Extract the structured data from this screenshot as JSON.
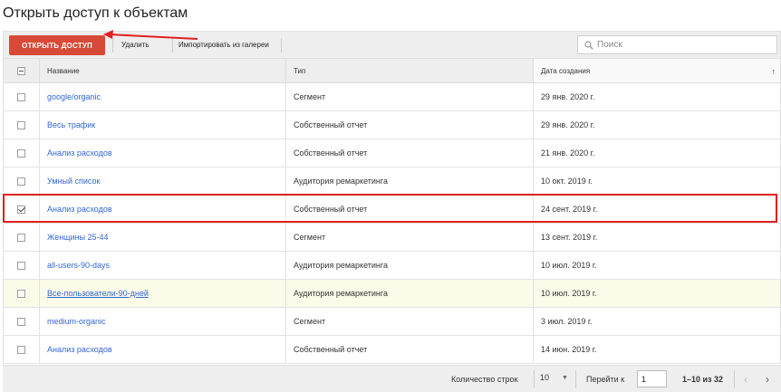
{
  "page": {
    "title": "Открыть доступ к объектам"
  },
  "toolbar": {
    "share_label": "ОТКРЫТЬ ДОСТУП",
    "delete_label": "Удалить",
    "import_label": "Импортировать из галереи",
    "search_placeholder": "Поиск"
  },
  "table": {
    "headers": {
      "name": "Название",
      "type": "Тип",
      "date": "Дата создания"
    },
    "sorted_by": "Дата создания",
    "sort_indicator": "↑",
    "rows": [
      {
        "name": "google/organic",
        "type": "Сегмент",
        "date": "29 янв. 2020 г.",
        "checked": false
      },
      {
        "name": "Весь трафик",
        "type": "Собственный отчет",
        "date": "29 янв. 2020 г.",
        "checked": false
      },
      {
        "name": "Анализ расходов",
        "type": "Собственный отчет",
        "date": "21 янв. 2020 г.",
        "checked": false
      },
      {
        "name": "Умный список",
        "type": "Аудитория ремаркетинга",
        "date": "10 окт. 2019 г.",
        "checked": false
      },
      {
        "name": "Анализ расходов",
        "type": "Собственный отчет",
        "date": "24 сент. 2019 г.",
        "checked": true
      },
      {
        "name": "Женщины 25-44",
        "type": "Сегмент",
        "date": "13 сент. 2019 г.",
        "checked": false
      },
      {
        "name": "all-users-90-days",
        "type": "Аудитория ремаркетинга",
        "date": "10 июл. 2019 г.",
        "checked": false
      },
      {
        "name": "Все-пользователи-90-дней",
        "type": "Аудитория ремаркетинга",
        "date": "10 июл. 2019 г.",
        "checked": false
      },
      {
        "name": "medium-organic",
        "type": "Сегмент",
        "date": "3 июл. 2019 г.",
        "checked": false
      },
      {
        "name": "Анализ расходов",
        "type": "Собственный отчет",
        "date": "14 июн. 2019 г.",
        "checked": false
      }
    ]
  },
  "footer": {
    "rows_label": "Количество строк",
    "rows_value": "10",
    "goto_label": "Перейти к",
    "goto_value": "1",
    "range_text": "1–10 из 32",
    "prev_icon": "chevron-left-icon",
    "next_icon": "chevron-right-icon"
  },
  "colors": {
    "accent_button": "#d84a38",
    "link": "#3367d6",
    "annotation": "#e02020",
    "hover_row": "#fafbe8"
  }
}
